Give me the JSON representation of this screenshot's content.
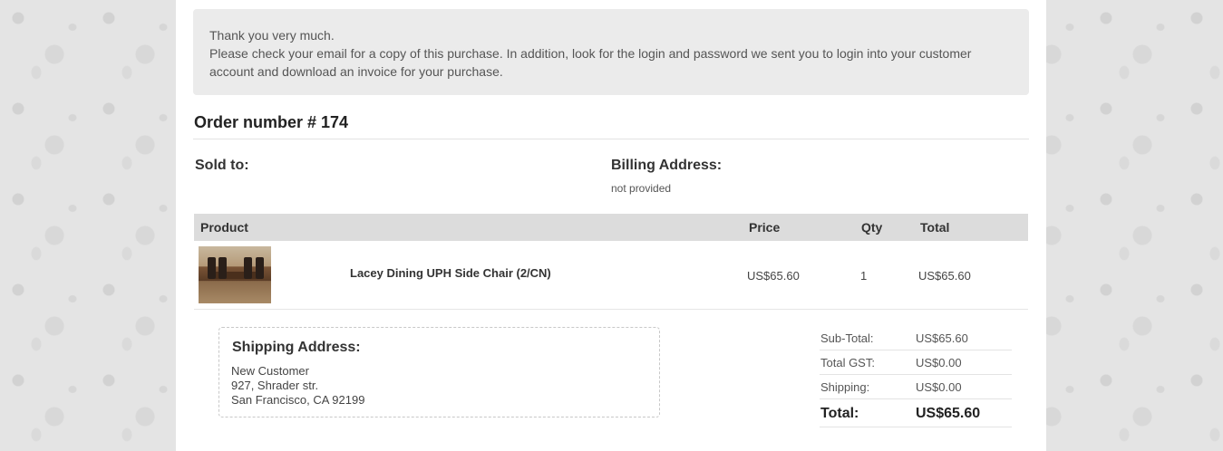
{
  "notice": {
    "line1": "Thank you very much.",
    "line2": "Please check your email for a copy of this purchase. In addition, look for the login and password we sent you to login into your customer",
    "line3": "account and download an invoice for your purchase."
  },
  "order": {
    "title": "Order number # 174"
  },
  "sold_to": {
    "label": "Sold to:"
  },
  "billing": {
    "label": "Billing Address:",
    "value": "not provided"
  },
  "table": {
    "headers": {
      "product": "Product",
      "price": "Price",
      "qty": "Qty",
      "total": "Total"
    },
    "rows": [
      {
        "name": "Lacey Dining UPH Side Chair (2/CN)",
        "price": "US$65.60",
        "qty": "1",
        "total": "US$65.60"
      }
    ]
  },
  "shipping": {
    "label": "Shipping Address:",
    "name": "New Customer",
    "street": "927, Shrader str.",
    "city": "San Francisco, CA 92199"
  },
  "totals": {
    "subtotal_label": "Sub-Total:",
    "subtotal": "US$65.60",
    "gst_label": "Total GST:",
    "gst": "US$0.00",
    "shipping_label": "Shipping:",
    "shipping": "US$0.00",
    "total_label": "Total:",
    "total": "US$65.60"
  }
}
